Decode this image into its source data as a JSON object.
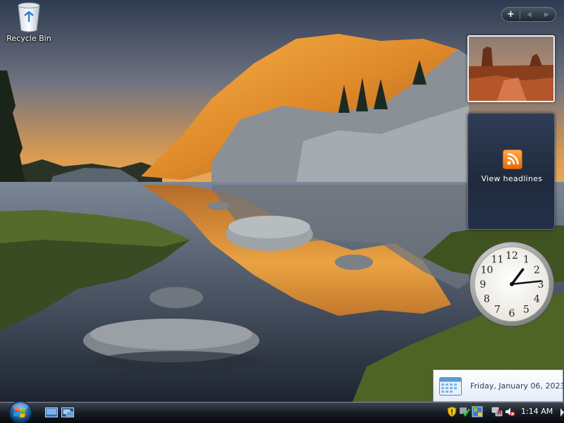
{
  "desktop": {
    "icons": [
      {
        "label": "Recycle Bin",
        "icon": "recycle-bin-icon"
      }
    ]
  },
  "sidebar": {
    "controls": {
      "add": "+",
      "prev": "◀",
      "next": "▶"
    },
    "feed_gadget": {
      "label": "View headlines",
      "icon": "rss-icon"
    },
    "clock_gadget": {
      "numerals": [
        "12",
        "1",
        "2",
        "3",
        "4",
        "5",
        "6",
        "7",
        "8",
        "9",
        "10",
        "11"
      ],
      "time": {
        "hours": 1,
        "minutes": 14
      }
    }
  },
  "date_popup": {
    "text": "Friday, January 06, 2023",
    "icon": "calendar-icon"
  },
  "taskbar": {
    "start_icon": "windows-orb-icon",
    "quick_launch": [
      "show-desktop-icon",
      "switch-windows-icon"
    ],
    "tray_icons": [
      "security-shield-icon",
      "update-icon",
      "app-icon",
      "network-icon",
      "volume-muted-icon"
    ],
    "clock": "1:14 AM"
  },
  "colors": {
    "taskbar": "#1a2028",
    "accent": "#ff8a1e",
    "sky_top": "#2e3b50",
    "sky_bottom": "#d99a52"
  }
}
